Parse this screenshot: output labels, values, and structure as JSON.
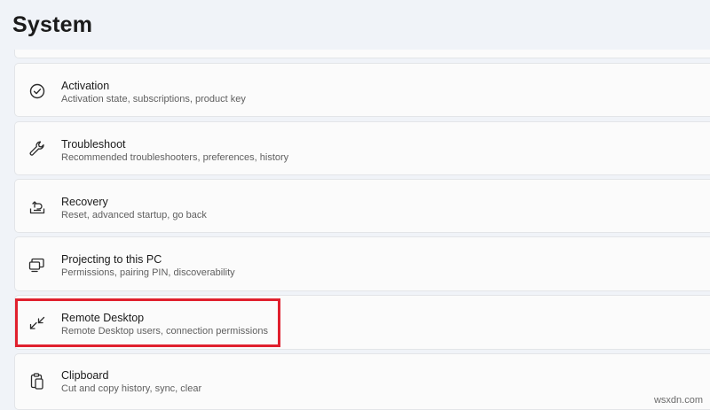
{
  "page": {
    "title": "System"
  },
  "items": [
    {
      "title": "Activation",
      "subtitle": "Activation state, subscriptions, product key",
      "icon": "checkmark-circle-icon"
    },
    {
      "title": "Troubleshoot",
      "subtitle": "Recommended troubleshooters, preferences, history",
      "icon": "wrench-icon"
    },
    {
      "title": "Recovery",
      "subtitle": "Reset, advanced startup, go back",
      "icon": "recovery-icon"
    },
    {
      "title": "Projecting to this PC",
      "subtitle": "Permissions, pairing PIN, discoverability",
      "icon": "projecting-icon"
    },
    {
      "title": "Remote Desktop",
      "subtitle": "Remote Desktop users, connection permissions",
      "icon": "remote-desktop-icon"
    },
    {
      "title": "Clipboard",
      "subtitle": "Cut and copy history, sync, clear",
      "icon": "clipboard-icon"
    }
  ],
  "annotation": {
    "highlight_color": "#e0202e"
  },
  "watermark": {
    "text": "wsxdn.com"
  }
}
